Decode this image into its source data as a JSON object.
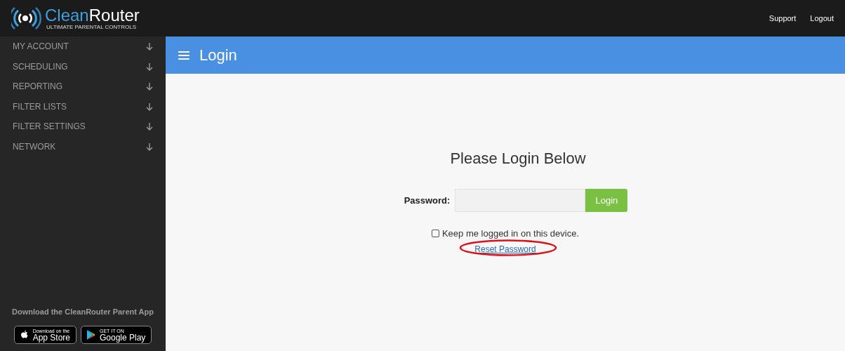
{
  "logo": {
    "name_lead": "Clean",
    "name_rest": "Router",
    "tagline": "ULTIMATE PARENTAL CONTROLS"
  },
  "top_links": [
    "Support",
    "Logout"
  ],
  "sidebar": {
    "items": [
      {
        "label": "MY ACCOUNT",
        "expanded": false
      },
      {
        "label": "SCHEDULING",
        "expanded": false
      },
      {
        "label": "REPORTING",
        "expanded": false
      },
      {
        "label": "FILTER LISTS",
        "expanded": false
      },
      {
        "label": "FILTER SETTINGS",
        "expanded": false
      },
      {
        "label": "NETWORK",
        "expanded": false
      }
    ],
    "app_promo": "Download the CleanRouter Parent App",
    "badges": [
      {
        "kind": "apple",
        "small": "Download on the",
        "big": "App Store"
      },
      {
        "kind": "google",
        "small": "GET IT ON",
        "big": "Google Play"
      }
    ]
  },
  "header": {
    "title": "Login"
  },
  "login": {
    "heading": "Please Login Below",
    "password_label": "Password:",
    "button": "Login",
    "remember": {
      "label": "Keep me logged in on this device.",
      "checked": false
    },
    "reset_link": "Reset Password",
    "highlight_reset": true
  }
}
